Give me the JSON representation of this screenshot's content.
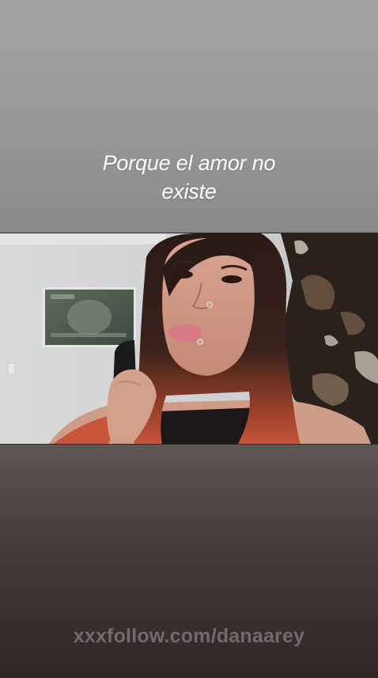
{
  "story": {
    "caption": "Porque el amor no\nexiste",
    "watermark": "xxxfollow.com/danaarey"
  },
  "colors": {
    "caption_text": "#ffffff",
    "background_top": "#a3a3a3",
    "background_bottom": "#2f2526",
    "watermark_text": "#c8bec0",
    "hair_accent": "#c8553a"
  },
  "icons": {
    "frame_picture": "framed-dollar-bill-picture"
  }
}
